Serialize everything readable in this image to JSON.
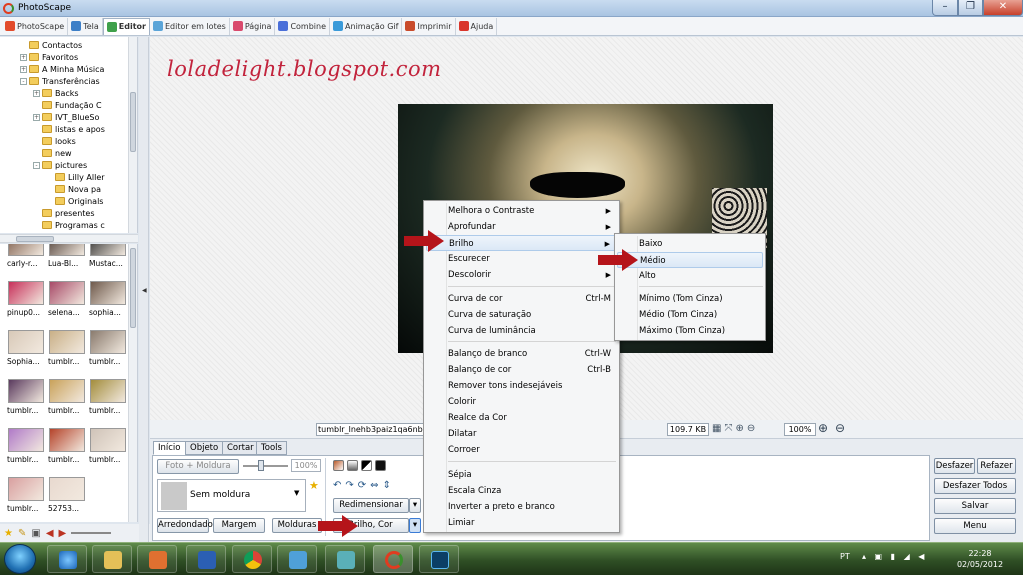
{
  "window": {
    "title": "PhotoScape",
    "min": "–",
    "max": "❐",
    "close": "✕"
  },
  "tabs": [
    {
      "label": "PhotoScape",
      "color": "#e24b2b"
    },
    {
      "label": "Tela",
      "color": "#3d7fc7"
    },
    {
      "label": "Editor",
      "color": "#3fa04b",
      "active": true
    },
    {
      "label": "Editor em lotes",
      "color": "#5aa4d8"
    },
    {
      "label": "Página",
      "color": "#d94a6d"
    },
    {
      "label": "Combine",
      "color": "#4a6fd9"
    },
    {
      "label": "Animação Gif",
      "color": "#3a9ad9"
    },
    {
      "label": "Imprimir",
      "color": "#c94b2b"
    },
    {
      "label": "Ajuda",
      "color": "#d9352b"
    }
  ],
  "tree": {
    "items": [
      {
        "label": "Contactos",
        "level": 2
      },
      {
        "label": "Favoritos",
        "level": 2,
        "expander": "+"
      },
      {
        "label": "A Minha Música",
        "level": 2,
        "expander": "+"
      },
      {
        "label": "Transferências",
        "level": 2,
        "expander": "-"
      },
      {
        "label": "Backs",
        "level": 3,
        "expander": "+"
      },
      {
        "label": "Fundação C",
        "level": 3
      },
      {
        "label": "IVT_BlueSo",
        "level": 3,
        "expander": "+"
      },
      {
        "label": "listas e apos",
        "level": 3
      },
      {
        "label": "looks",
        "level": 3
      },
      {
        "label": "new",
        "level": 3
      },
      {
        "label": "pictures",
        "level": 3,
        "expander": "-"
      },
      {
        "label": "Lilly Aller",
        "level": 4
      },
      {
        "label": "Nova pa",
        "level": 4
      },
      {
        "label": "Originals",
        "level": 4
      },
      {
        "label": "presentes",
        "level": 3
      },
      {
        "label": "Programas c",
        "level": 3
      }
    ]
  },
  "thumbnails": [
    {
      "label": "carly-r...",
      "color": "#7b5a48"
    },
    {
      "label": "Lua-Bl...",
      "color": "#4c3b33"
    },
    {
      "label": "Mustac...",
      "color": "#2b2b2b"
    },
    {
      "label": "pinup0...",
      "color": "#c7305a"
    },
    {
      "label": "selena...",
      "color": "#a84a68"
    },
    {
      "label": "sophia...",
      "color": "#6f5a4c"
    },
    {
      "label": "Sophia...",
      "color": "#d8c9b8"
    },
    {
      "label": "tumblr...",
      "color": "#c9b087"
    },
    {
      "label": "tumblr...",
      "color": "#8a7b6e"
    },
    {
      "label": "tumblr...",
      "color": "#5a3a5e"
    },
    {
      "label": "tumblr...",
      "color": "#c9a25a"
    },
    {
      "label": "tumblr...",
      "color": "#a38d3c"
    },
    {
      "label": "tumblr...",
      "color": "#b07ac8"
    },
    {
      "label": "tumblr...",
      "color": "#b5432a"
    },
    {
      "label": "tumblr...",
      "color": "#cfc3b8"
    },
    {
      "label": "tumblr...",
      "color": "#d9a0a0"
    },
    {
      "label": "52753...",
      "color": "#e8d9cf"
    }
  ],
  "canvas": {
    "watermark": "loladelight.blogspot.com"
  },
  "status": {
    "filename": "tumblr_lnehb3paiz1qa6nblo",
    "filesize": "109.7 KB",
    "zoom": "100%"
  },
  "bottom_tabs": [
    "Início",
    "Objeto",
    "Cortar",
    "Tools"
  ],
  "panel": {
    "foto_moldura": "Foto + Moldura",
    "opacity": "100%",
    "frame_name": "Sem moldura",
    "redimensionar": "Redimensionar",
    "arredondado": "Arredondado",
    "margem": "Margem",
    "molduras": "Molduras",
    "brilho_cor": "Brilho, Cor"
  },
  "right_buttons": {
    "desfazer": "Desfazer",
    "refazer": "Refazer",
    "desfazer_todos": "Desfazer Todos",
    "salvar": "Salvar",
    "menu": "Menu"
  },
  "context_menu": {
    "items": [
      {
        "label": "Melhora o Contraste",
        "submenu": true
      },
      {
        "label": "Aprofundar",
        "submenu": true
      },
      {
        "label": "Brilho",
        "submenu": true,
        "highlight": true
      },
      {
        "label": "Escurecer",
        "submenu": true
      },
      {
        "label": "Descolorir",
        "submenu": true
      },
      {
        "label": "Curva de cor",
        "shortcut": "Ctrl-M"
      },
      {
        "label": "Curva de saturação"
      },
      {
        "label": "Curva de luminância"
      },
      {
        "label": "Balanço de branco",
        "shortcut": "Ctrl-W"
      },
      {
        "label": "Balanço de cor",
        "shortcut": "Ctrl-B"
      },
      {
        "label": "Remover tons indesejáveis"
      },
      {
        "label": "Colorir"
      },
      {
        "label": "Realce da Cor"
      },
      {
        "label": "Dilatar"
      },
      {
        "label": "Corroer"
      },
      {
        "label": "Sépia"
      },
      {
        "label": "Escala Cinza"
      },
      {
        "label": "Inverter a preto e branco"
      },
      {
        "label": "Limiar"
      }
    ]
  },
  "submenu": {
    "items": [
      {
        "label": "Baixo"
      },
      {
        "label": "Médio",
        "highlight": true
      },
      {
        "label": "Alto"
      },
      {
        "label": "Mínimo (Tom Cinza)"
      },
      {
        "label": "Médio (Tom Cinza)"
      },
      {
        "label": "Máximo (Tom Cinza)"
      }
    ]
  },
  "taskbar": {
    "lang": "PT",
    "time": "22:28",
    "date": "02/05/2012"
  },
  "colors": {
    "accent_red": "#b5141a",
    "watermark": "#c2233c"
  }
}
